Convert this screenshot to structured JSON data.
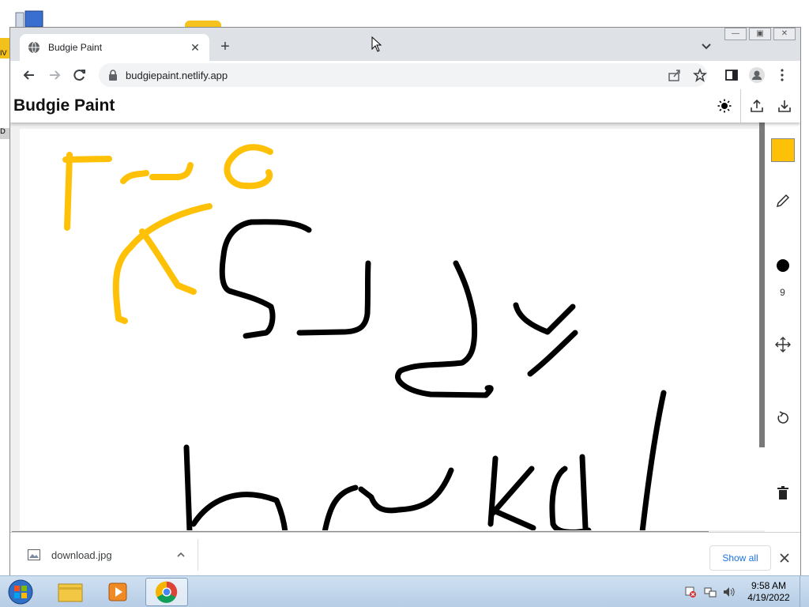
{
  "browser": {
    "tab_title": "Budgie Paint",
    "url": "budgiepaint.netlify.app",
    "new_tab_symbol": "+",
    "close_tab_symbol": "✕"
  },
  "app": {
    "title": "Budgie Paint",
    "header_icons": [
      "theme-toggle-icon",
      "upload-icon",
      "download-icon"
    ],
    "tools": {
      "selected_color": "#FFC107",
      "brush_size": "9",
      "tool_icons": [
        "pencil-icon",
        "brush-size-icon",
        "move-icon",
        "undo-icon",
        "trash-icon"
      ]
    },
    "drawing_colors": {
      "ink_yellow": "#FFC107",
      "ink_black": "#000000"
    }
  },
  "downloads": {
    "file_name": "download.jpg",
    "show_all": "Show all"
  },
  "taskbar": {
    "time": "9:58 AM",
    "date": "4/19/2022",
    "pinned_icons": [
      "start-orb-icon",
      "file-explorer-icon",
      "media-player-icon",
      "chrome-icon"
    ],
    "tray_icons": [
      "action-center-icon",
      "network-icon",
      "volume-icon"
    ]
  },
  "desktop": {
    "edge_label_left": "IV",
    "edge_label_left2": "D"
  }
}
